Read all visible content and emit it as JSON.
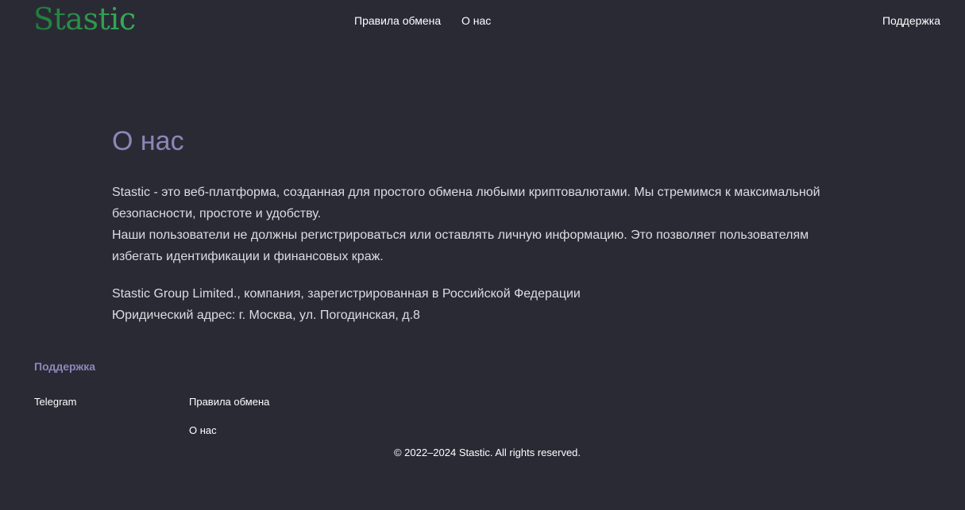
{
  "header": {
    "logo": "Stastic",
    "nav": {
      "rules": "Правила обмена",
      "about": "О нас"
    },
    "support": "Поддержка"
  },
  "main": {
    "title": "О нас",
    "intro_line1": "Stastic - это веб-платформа, созданная для простого обмена любыми криптовалютами. Мы стремимся к максимальной безопасности, простоте и удобству.",
    "intro_line2": "Наши пользователи не должны регистрироваться или оставлять личную информацию. Это позволяет пользователям избегать идентификации и финансовых краж.",
    "company": "Stastic Group Limited., компания, зарегистрированная в Российской Федерации",
    "address": "Юридический адрес: г. Москва, ул. Погодинская, д.8"
  },
  "footer": {
    "heading": "Поддержка",
    "telegram": "Telegram",
    "rules": "Правила обмена",
    "about": "О нас",
    "copyright": "© 2022–2024 Stastic. All rights reserved."
  },
  "colors": {
    "background": "#2a2a35",
    "accent": "#8b87b8",
    "logo_green": "#2f9a4e",
    "text": "#ffffff",
    "body_text": "#dcdce2"
  }
}
